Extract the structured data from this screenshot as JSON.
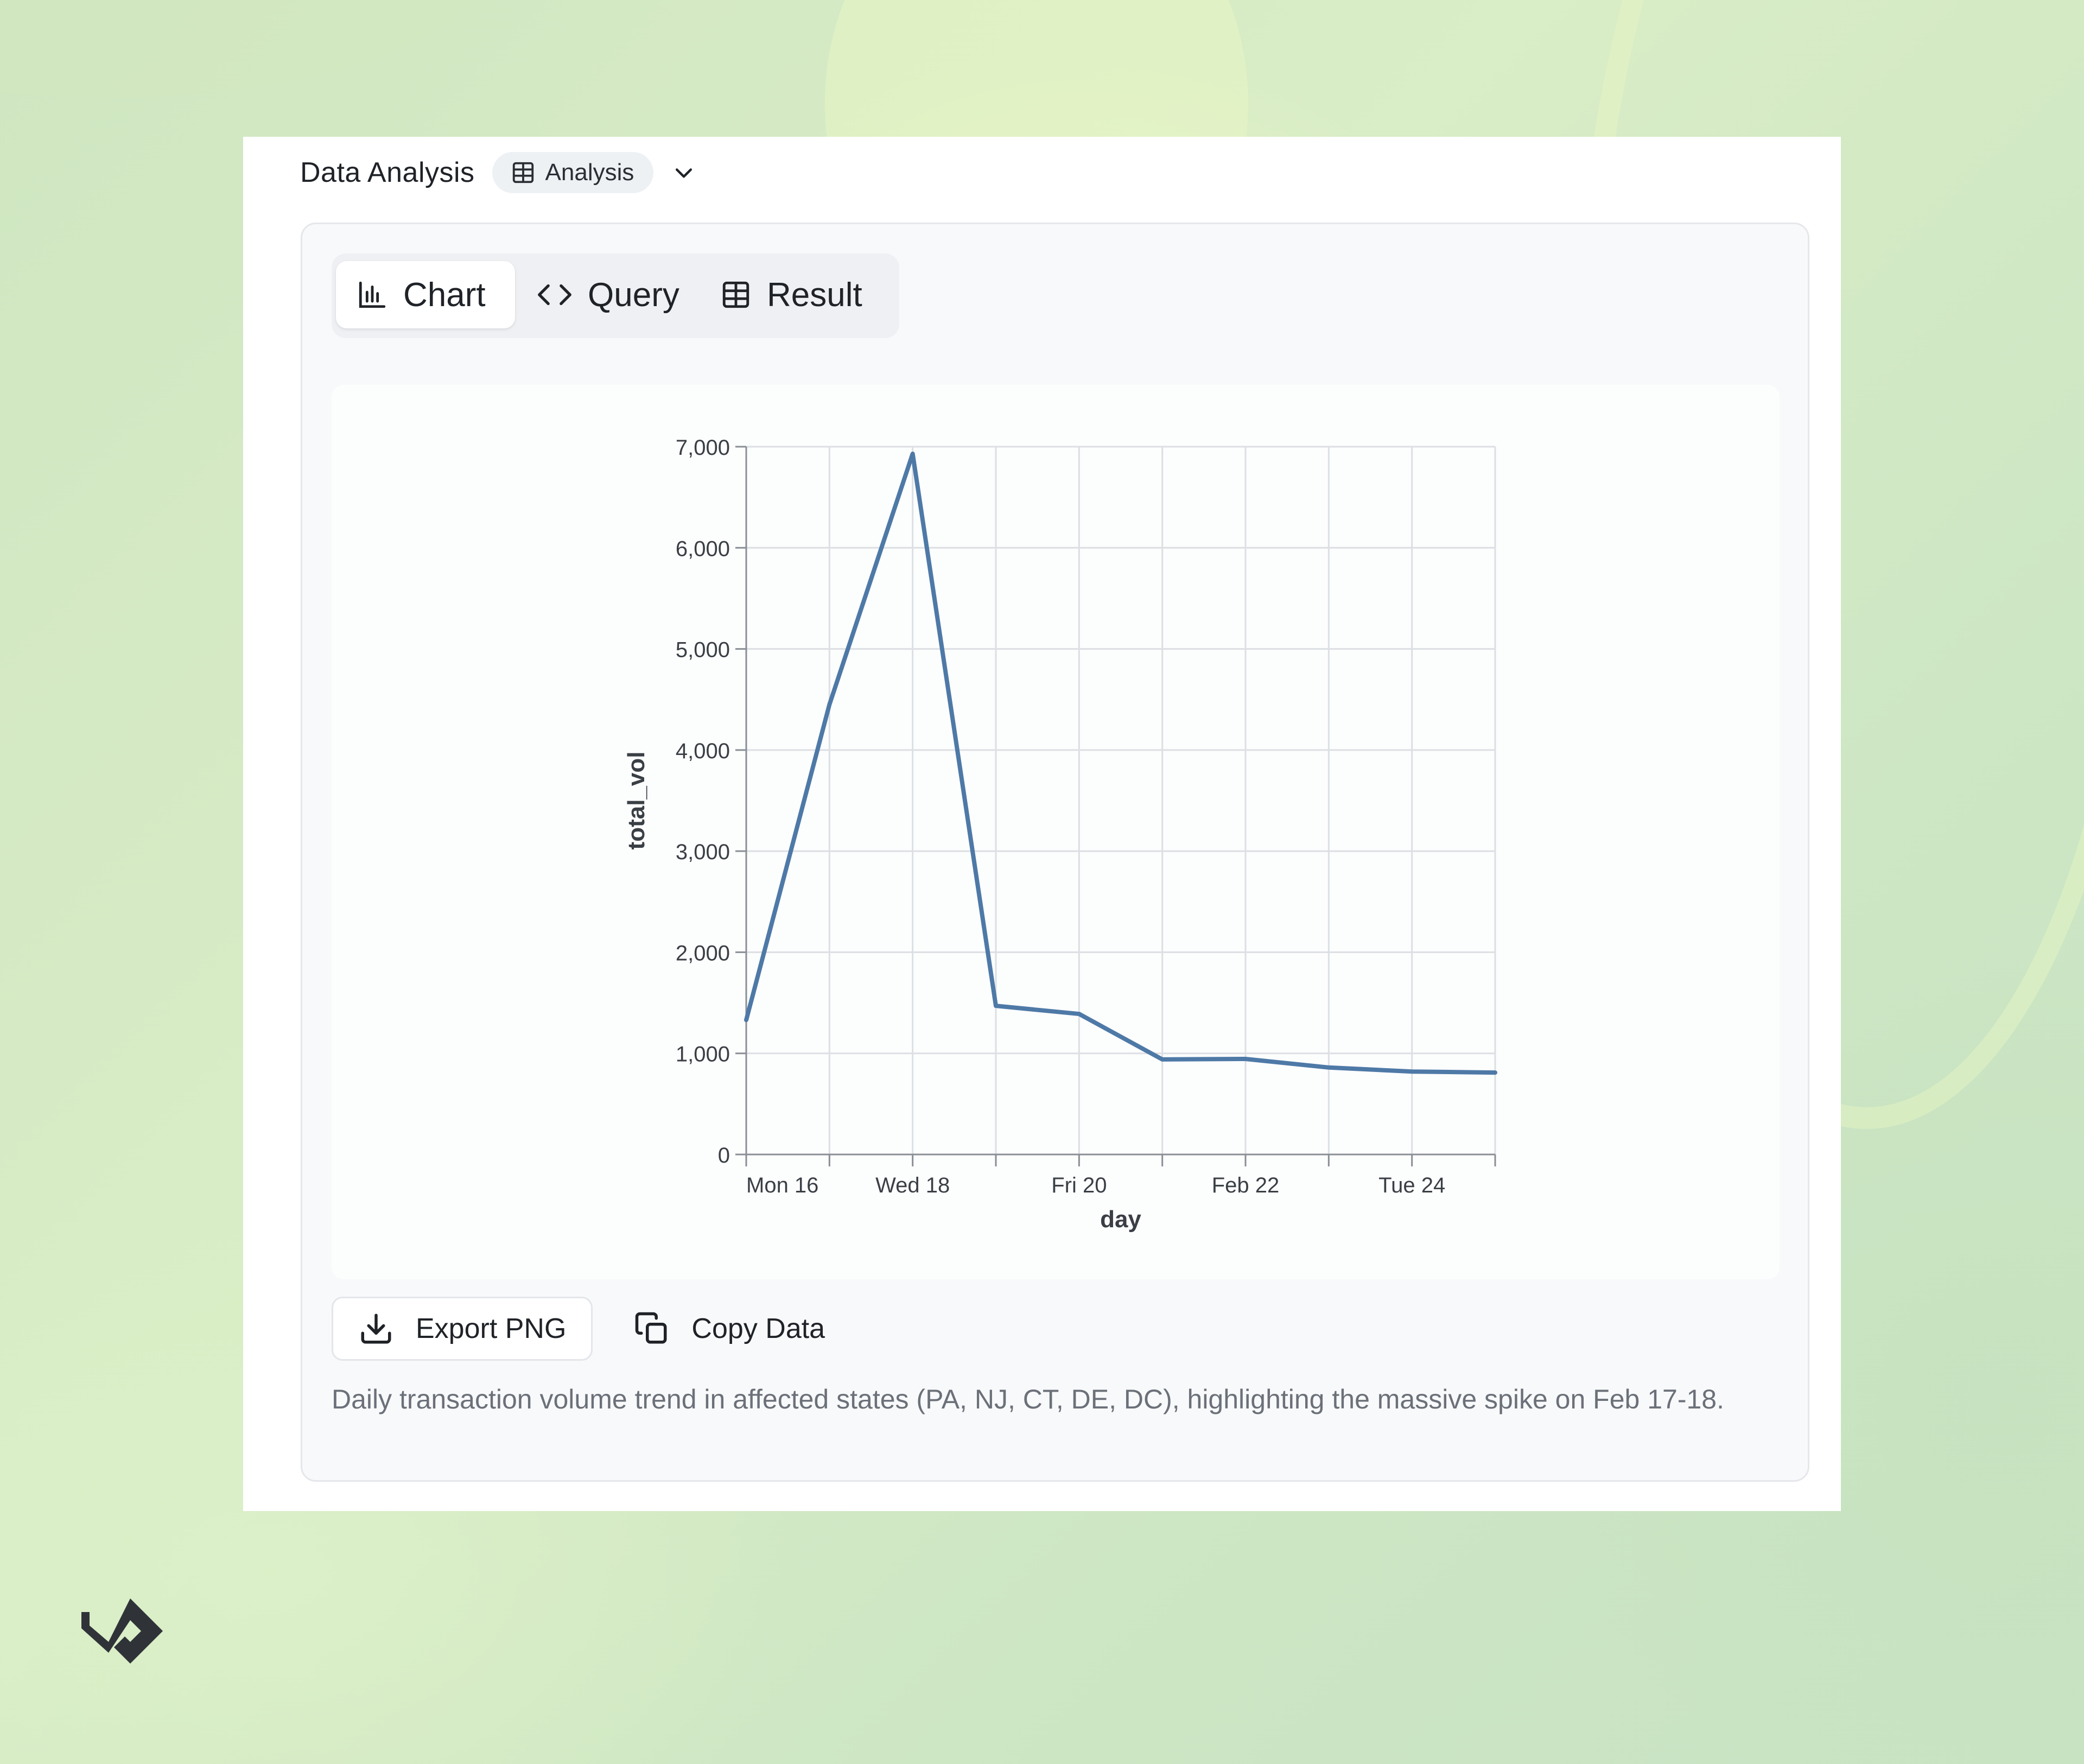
{
  "header": {
    "title": "Data Analysis",
    "badge_label": "Analysis",
    "badge_icon": "table-icon",
    "dropdown_icon": "chevron-down-icon"
  },
  "tabs": [
    {
      "label": "Chart",
      "icon": "bar-chart-icon",
      "active": true
    },
    {
      "label": "Query",
      "icon": "code-icon",
      "active": false
    },
    {
      "label": "Result",
      "icon": "table-icon",
      "active": false
    }
  ],
  "actions": {
    "export_label": "Export PNG",
    "export_icon": "download-icon",
    "copy_label": "Copy Data",
    "copy_icon": "copy-icon"
  },
  "caption": "Daily transaction volume trend in affected states (PA, NJ, CT, DE, DC), highlighting the massive spike on Feb 17-18.",
  "chart_data": {
    "type": "line",
    "x": [
      "2026-02-16",
      "2026-02-17",
      "2026-02-18",
      "2026-02-19",
      "2026-02-20",
      "2026-02-21",
      "2026-02-22",
      "2026-02-23",
      "2026-02-24",
      "2026-02-25"
    ],
    "series": [
      {
        "values": [
          1330,
          4450,
          6930,
          1470,
          1390,
          940,
          945,
          860,
          820,
          810
        ],
        "color": "#4e79a7"
      }
    ],
    "xlabel": "day",
    "ylabel": "total_vol",
    "x_tick_labels": [
      "Mon 16",
      "Wed 18",
      "Fri 20",
      "Feb 22",
      "Tue 24"
    ],
    "y_ticks": [
      0,
      1000,
      2000,
      3000,
      4000,
      5000,
      6000,
      7000
    ],
    "y_tick_labels": [
      "0",
      "1,000",
      "2,000",
      "3,000",
      "4,000",
      "5,000",
      "6,000",
      "7,000"
    ],
    "ylim": [
      0,
      7000
    ],
    "xlim": [
      "2026-02-16",
      "2026-02-25"
    ],
    "grid": true
  }
}
